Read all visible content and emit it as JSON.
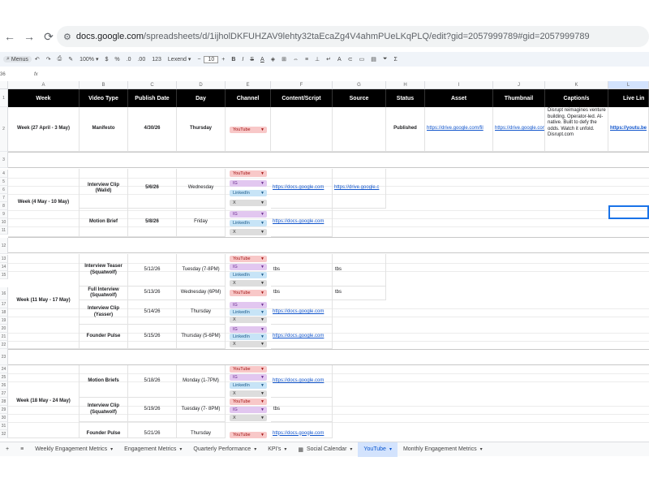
{
  "browser": {
    "url_domain": "docs.google.com",
    "url_path": "/spreadsheets/d/1ijholDKFUHZAV9lehty32taEcaZg4V4ahmPUeLKqPLQ/edit?gid=2057999789#gid=2057999789"
  },
  "toolbar": {
    "menus": "Menus",
    "zoom": "100%",
    "currency": "$",
    "percent": "%",
    "dec_less": ".0",
    "dec_more": ".00",
    "num_format": "123",
    "font": "Lexend",
    "font_size": "10"
  },
  "formula_bar": {
    "cell_ref": "36",
    "fx": "fx"
  },
  "columns": [
    "A",
    "B",
    "C",
    "D",
    "E",
    "F",
    "G",
    "H",
    "I",
    "J",
    "K",
    "L"
  ],
  "headers": [
    "Week",
    "Video Type",
    "Publish Date",
    "Day",
    "Channel",
    "Content/Script",
    "Source",
    "Status",
    "Asset",
    "Thumbnail",
    "Caption/s",
    "Live Lin"
  ],
  "rows": [
    {
      "week": "Week (27 April - 3 May)",
      "video_type": "Manifesto",
      "publish_date": "4/30/26",
      "day": "Thursday",
      "status": "Published",
      "asset": "https://drive.google.com/fil",
      "thumbnail": "https://drive.google.com",
      "caption": "Disrupt reimagines venture building. Operator-led. AI-native. Built to defy the odds. Watch it unfold. Disrupt.com",
      "live_link": "https://youtu.be"
    },
    {
      "week": "Week (4 May - 10 May)",
      "video_type": "Interview Clip (Walid)",
      "publish_date": "5/6/26",
      "day": "Wednesday",
      "content": "https://docs.google.com",
      "source": "https://drive.google.c"
    },
    {
      "video_type": "Motion Brief",
      "publish_date": "5/8/26",
      "day": "Friday",
      "content": "https://docs.google.com"
    },
    {
      "week": "Week (11 May - 17 May)",
      "video_type": "Interview Teaser (Squatwolf)",
      "publish_date": "5/12/26",
      "day": "Tuesday (7-8PM)",
      "content": "tbs",
      "source": "tbs"
    },
    {
      "video_type": "Full Interview (Squatwolf)",
      "publish_date": "5/13/26",
      "day": "Wednesday (6PM)",
      "content": "tbs",
      "source": "tbs"
    },
    {
      "video_type": "Interview Clip (Yasser)",
      "publish_date": "5/14/26",
      "day": "Thursday",
      "content": "https://docs.google.com"
    },
    {
      "video_type": "Founder Pulse",
      "publish_date": "5/15/26",
      "day": "Thursday (5-6PM)",
      "content": "https://docs.google.com"
    },
    {
      "week": "Week (18 May - 24 May)",
      "video_type": "Motion Briefs",
      "publish_date": "5/18/26",
      "day": "Monday (1-7PM)",
      "content": "https://docs.google.com"
    },
    {
      "video_type": "Interview Clip (Squatwolf)",
      "publish_date": "5/19/26",
      "day": "Tuesday (7- 8PM)",
      "content": "tbs"
    },
    {
      "video_type": "Founder Pulse",
      "publish_date": "5/21/26",
      "day": "Thursday",
      "content": "https://docs.google.com"
    }
  ],
  "channels": {
    "youtube": "YouTube",
    "ig": "IG",
    "linkedin": "LinkedIn",
    "x": "X"
  },
  "row_numbers": [
    "1",
    "2",
    "3",
    "4",
    "5",
    "6",
    "7",
    "8",
    "9",
    "10",
    "11",
    "12",
    "13",
    "14",
    "15",
    "16",
    "17",
    "18",
    "19",
    "20",
    "21",
    "22",
    "23",
    "24",
    "25",
    "26",
    "27",
    "28",
    "29",
    "30",
    "31",
    "32"
  ],
  "tabs": [
    {
      "label": "Weekly Engagement Metrics"
    },
    {
      "label": "Engagement Metrics"
    },
    {
      "label": "Quarterly Performance"
    },
    {
      "label": "KPI's"
    },
    {
      "label": "Social Calendar"
    },
    {
      "label": "YouTube",
      "active": true
    },
    {
      "label": "Monthly Engagement Metrics"
    }
  ],
  "colors": {
    "youtube_chip": "#f8c8c8",
    "ig_chip": "#e2c7f0",
    "linkedin_chip": "#c7e4f7",
    "x_chip": "#dddddd",
    "header_bg": "#000000",
    "active_tab": "#d3e3fd"
  }
}
